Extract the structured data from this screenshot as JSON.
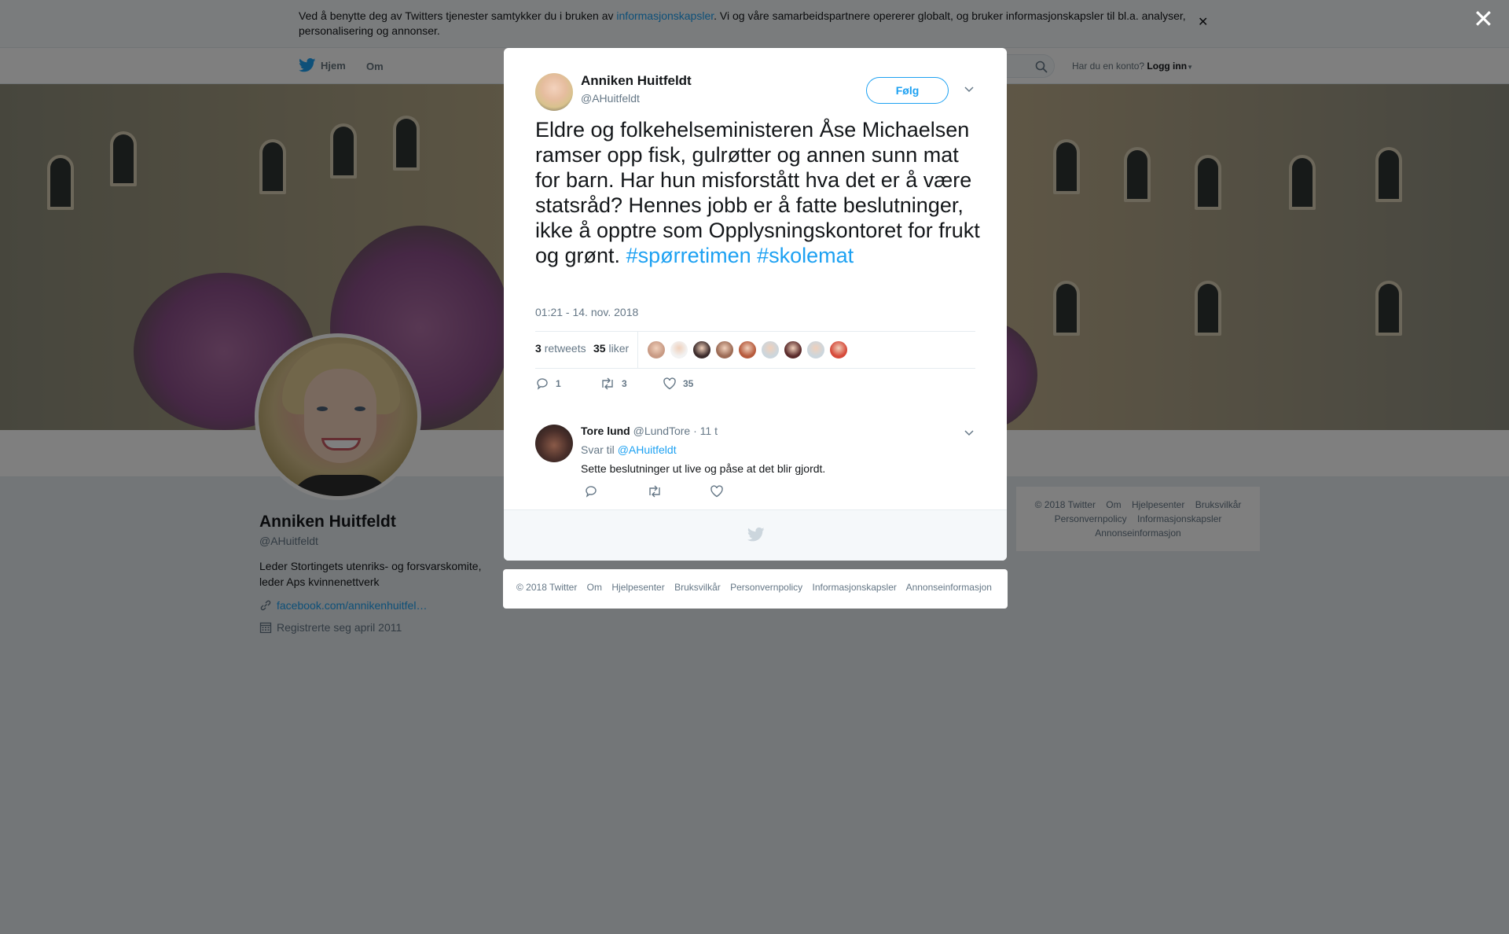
{
  "cookie": {
    "text_before": "Ved å benytte deg av Twitters tjenester samtykker du i bruken av ",
    "link": "informasjonskapsler",
    "text_after": ". Vi og våre samarbeidspartnere opererer globalt, og bruker informasjonskapsler til bl.a. analyser, personalisering og annonser."
  },
  "nav": {
    "home": "Hjem",
    "about": "Om",
    "account_prompt": "Har du en konto?",
    "login": "Logg inn"
  },
  "profile": {
    "name": "Anniken Huitfeldt",
    "handle": "@AHuitfeldt",
    "bio": "Leder Stortingets utenriks- og forsvarskomite, leder Aps kvinnenettverk",
    "link": "facebook.com/annikenhuitfel…",
    "joined": "Registrerte seg april 2011"
  },
  "side_footer": {
    "links": [
      "© 2018 Twitter",
      "Om",
      "Hjelpesenter",
      "Bruksvilkår",
      "Personvernpolicy",
      "Informasjonskapsler",
      "Annonseinformasjon"
    ]
  },
  "tweet": {
    "author_name": "Anniken Huitfeldt",
    "author_handle": "@AHuitfeldt",
    "follow_label": "Følg",
    "text": "Eldre og folkehelseministeren Åse Michaelsen ramser opp fisk, gulrøtter og annen sunn mat for barn. Har hun misforstått hva det er å være statsråd? Hennes jobb er å fatte beslutninger, ikke å opptre som Opplysningskontoret for frukt og grønt. ",
    "hashtags": [
      "#spørretimen",
      "#skolemat"
    ],
    "timestamp": "01:21 - 14. nov. 2018",
    "retweets_count": "3",
    "retweets_label": "retweets",
    "likes_count": "35",
    "likes_label": "liker",
    "liker_avatar_colors": [
      "#c89a84",
      "#f2f2f2",
      "#3b2b2b",
      "#9c6b55",
      "#b65a3c",
      "#ccd6dd",
      "#5a2b2b",
      "#ccd6dd",
      "#d64a3a"
    ],
    "reply_count": "1",
    "retweet_count_action": "3",
    "like_count_action": "35"
  },
  "reply": {
    "name": "Tore lund",
    "handle": "@LundTore",
    "time": "· 11 t",
    "reply_to_label": "Svar til",
    "reply_to_handle": "@AHuitfeldt",
    "text": "Sette beslutninger ut live og påse at det blir gjordt."
  },
  "modal_footer": {
    "links": [
      "© 2018 Twitter",
      "Om",
      "Hjelpesenter",
      "Bruksvilkår",
      "Personvernpolicy",
      "Informasjonskapsler",
      "Annonseinformasjon"
    ]
  },
  "colors": {
    "accent": "#1da1f2",
    "text_primary": "#14171a",
    "text_secondary": "#657786"
  }
}
